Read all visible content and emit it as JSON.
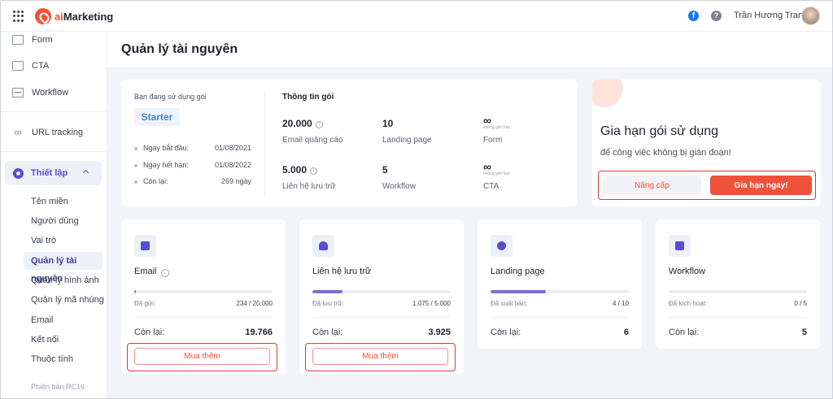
{
  "app": {
    "logo_prefix": "ai",
    "logo_suffix": "Marketing"
  },
  "topbar": {
    "facebook_glyph": "f",
    "help_glyph": "?",
    "user_name": "Trần Hương Trang"
  },
  "sidebar": {
    "items": [
      {
        "label": "Form",
        "icon": "form-icon"
      },
      {
        "label": "CTA",
        "icon": "cta-icon"
      },
      {
        "label": "Workflow",
        "icon": "workflow-icon"
      },
      {
        "label": "URL tracking",
        "icon": "link-icon"
      }
    ],
    "section": {
      "label": "Thiết lập",
      "icon": "gear-icon"
    },
    "subitems": [
      "Tên miền",
      "Người dùng",
      "Vai trò",
      "Quản lý tài nguyên",
      "Quản lý hình ảnh",
      "Quản lý mã nhúng",
      "Email",
      "Kết nối",
      "Thuộc tính"
    ],
    "active_subitem": "Quản lý tài nguyên",
    "version": "Phiên bản RC16"
  },
  "page": {
    "title": "Quản lý tài nguyên"
  },
  "plan": {
    "using_label": "Bạn đang sử dụng gói",
    "name": "Starter",
    "start_label": "Ngày bắt đầu:",
    "start_value": "01/08/2021",
    "end_label": "Ngày hết hạn:",
    "end_value": "01/08/2022",
    "remaining_label": "Còn lại:",
    "remaining_value": "269 ngày",
    "info_title": "Thông tin gói",
    "metrics": [
      {
        "value": "20.000",
        "label": "Email quảng cáo"
      },
      {
        "value": "10",
        "label": "Landing page"
      },
      {
        "value": "∞",
        "sub": "không giới hạn",
        "label": "Form"
      },
      {
        "value": "5.000",
        "label": "Liên hệ lưu trữ"
      },
      {
        "value": "5",
        "label": "Workflow"
      },
      {
        "value": "∞",
        "sub": "không giới hạn",
        "label": "CTA"
      }
    ]
  },
  "renew": {
    "title": "Gia hạn gói sử dụng",
    "subtitle": "để công việc không bị gián đoạn!",
    "upgrade_label": "Nâng cấp",
    "renew_label": "Gia hạn ngay!"
  },
  "resources": [
    {
      "title": "Email",
      "used_label": "Đã gửi:",
      "used_value": "234 / 20.000",
      "progress": 0.0117,
      "left_label": "Còn lại:",
      "left_value": "19.766",
      "buy_label": "Mua thêm",
      "icon": "mail-icon"
    },
    {
      "title": "Liên hệ lưu trữ",
      "used_label": "Đã lưu trữ:",
      "used_value": "1.075 / 5.000",
      "progress": 0.215,
      "left_label": "Còn lại:",
      "left_value": "3.925",
      "buy_label": "Mua thêm",
      "icon": "users-icon"
    },
    {
      "title": "Landing page",
      "used_label": "Đã xuất bản:",
      "used_value": "4 / 10",
      "progress": 0.4,
      "left_label": "Còn lại:",
      "left_value": "6",
      "icon": "globe-icon"
    },
    {
      "title": "Workflow",
      "used_label": "Đã kích hoạt:",
      "used_value": "0 / 5",
      "progress": 0,
      "left_label": "Còn lại:",
      "left_value": "5",
      "icon": "workflow-icon"
    }
  ],
  "colors": {
    "brand": "#f0513b",
    "accent": "#5b4bd6",
    "highlight_border": "#e3372f",
    "progress": "#7b72cf"
  }
}
